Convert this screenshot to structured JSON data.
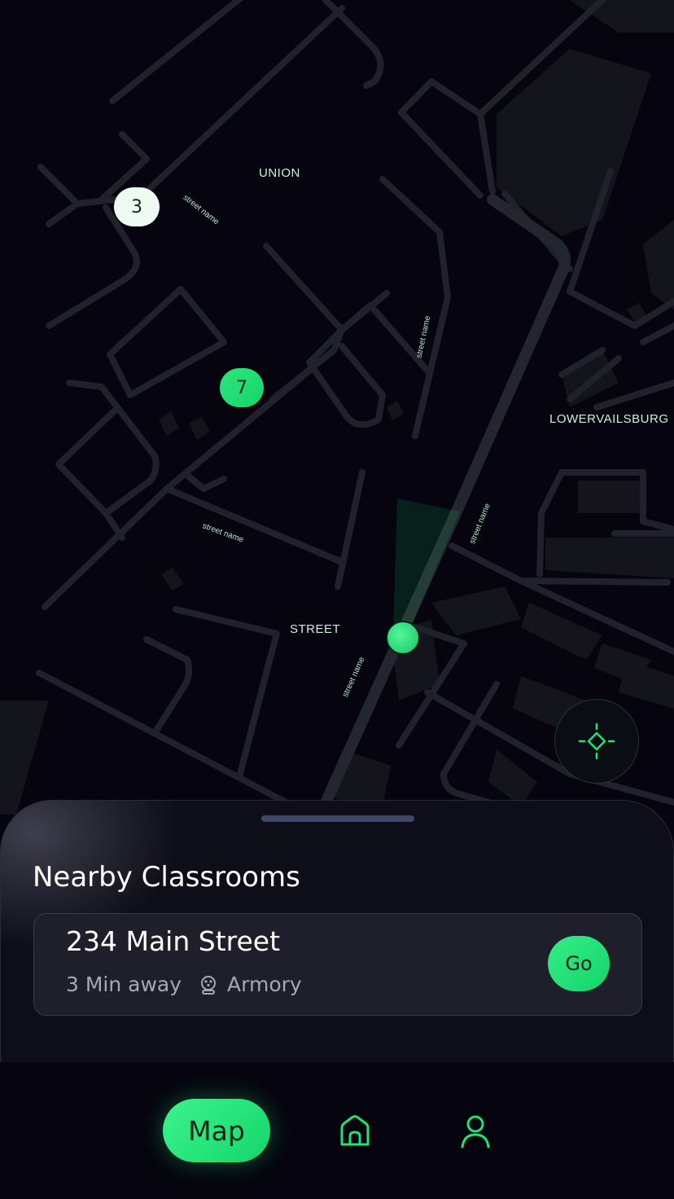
{
  "map": {
    "area_labels": {
      "union": "UNION",
      "lowervailsburg": "LOWERVAILSBURG",
      "street": "STREET"
    },
    "street_labels": [
      "street name",
      "street name",
      "street name",
      "street name",
      "street name"
    ],
    "clusters": {
      "white_count": "3",
      "green_count": "7"
    },
    "accent_color": "#1ee374"
  },
  "sheet": {
    "title": "Nearby Classrooms",
    "card": {
      "title": "234 Main Street",
      "distance": "3 Min away",
      "venue": "Armory",
      "go_label": "Go"
    }
  },
  "nav": {
    "map_label": "Map",
    "home_icon": "home-icon",
    "profile_icon": "user-icon"
  }
}
